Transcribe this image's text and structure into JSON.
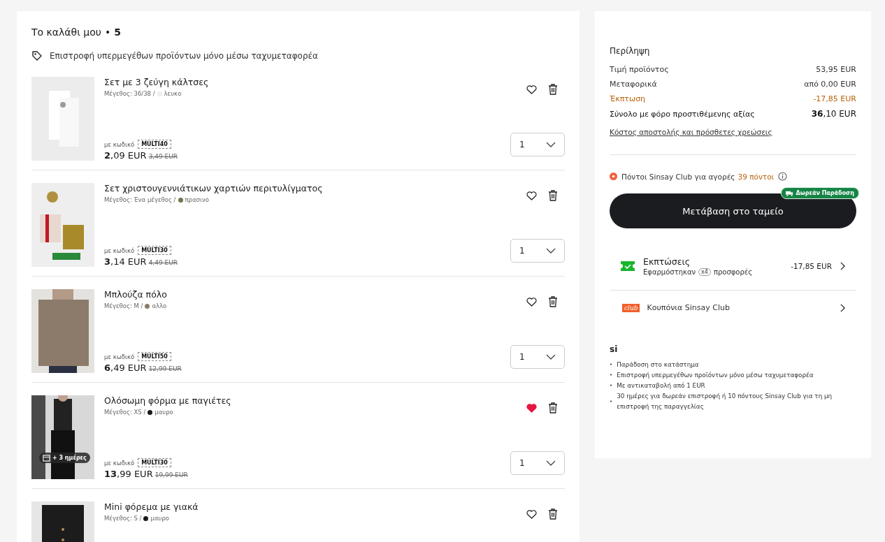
{
  "cart": {
    "title": "Το καλάθι μου",
    "separator": "•",
    "count": "5",
    "notice": "Επιστροφή υπερμεγέθων προϊόντων μόνο μέσω ταχυμεταφορέα",
    "items": [
      {
        "name": "Σετ με 3 ζεύγη κάλτσες",
        "size_label": "Μέγεθος: 36/38 /",
        "color": "#eeeef2",
        "color_name": "λευκο",
        "code_label": "με κωδικό",
        "code": "MULTI40",
        "price": "**2**,09 EUR",
        "old_price": "3,49 EUR",
        "quantity": "1",
        "favorite": false
      },
      {
        "name": "Σετ χριστουγεννιάτικων χαρτιών περιτυλίγματος",
        "size_label": "Μέγεθος:  Ένα μέγεθος /",
        "color": "#6b7a4a",
        "color_name": "πρασινο",
        "code_label": "με κωδικό",
        "code": "MULTI30",
        "price": "**3**,14 EUR",
        "old_price": "4,49 EUR",
        "quantity": "1",
        "favorite": false
      },
      {
        "name": "Μπλούζα πόλο",
        "size_label": "Μέγεθος: M /",
        "color": "#8c7b6b",
        "color_name": "αλλο",
        "code_label": "με κωδικό",
        "code": "MULTI50",
        "price": "**6**,49 EUR",
        "old_price": "12,99 EUR",
        "quantity": "1",
        "favorite": false
      },
      {
        "name": "Ολόσωμη φόρμα με παγιέτες",
        "size_label": "Μέγεθος: XS /",
        "color": "#1a1a1a",
        "color_name": "μαυρο",
        "badge": "+ 3 ημέρες",
        "code_label": "με κωδικό",
        "code": "MULTI30",
        "price": "**13**,99 EUR",
        "old_price": "19,99 EUR",
        "quantity": "1",
        "favorite": true
      },
      {
        "name": "Mini φόρεμα με γιακά",
        "size_label": "Μέγεθος: S /",
        "color": "#1a1a1a",
        "color_name": "μαυρο",
        "favorite": false
      }
    ]
  },
  "summary": {
    "title": "Περίληψη",
    "lines": [
      {
        "label": "Τιμή προϊόντος",
        "value": "53,95 EUR",
        "kind": "normal"
      },
      {
        "label": "Μεταφορικά",
        "value": "από 0,00 EUR",
        "kind": "normal"
      },
      {
        "label": "Έκπτωση",
        "value": "-17,85 EUR",
        "kind": "discount"
      }
    ],
    "total_label": "Σύνολο με φόρο προστιθέμενης αξίας",
    "total": "**36**,10 EUR",
    "costs_link": "Κόστος αποστολής και πρόσθετες χρεώσεις",
    "points_label": "Πόντοι Sinsay Club για αγορές",
    "points": "39 πόντοι",
    "checkout": "Μετάβαση στο ταμείο",
    "free_delivery": "Δωρεάν Παράδοση",
    "discounts": {
      "title": "Εκπτώσεις",
      "applied": "Εφαρμόστηκαν",
      "count": "x4",
      "offers": "προσφορές",
      "amount": "-17,85 EUR"
    },
    "coupons": {
      "logo": "club",
      "label": "Κουπόνια Sinsay Club"
    },
    "info_logo": "si",
    "bullet": "•",
    "info": [
      "Παράδοση στο κατάστημα",
      "Επιστροφή υπερμεγέθων προϊόντων μόνο μέσω ταχυμεταφορέα",
      "Με αντικαταβολή από 1 EUR",
      "30 ημέρες για δωρεάν επιστροφή ή 10 πόντους Sinsay Club για τη μη επιστροφή της παραγγελίας"
    ]
  }
}
